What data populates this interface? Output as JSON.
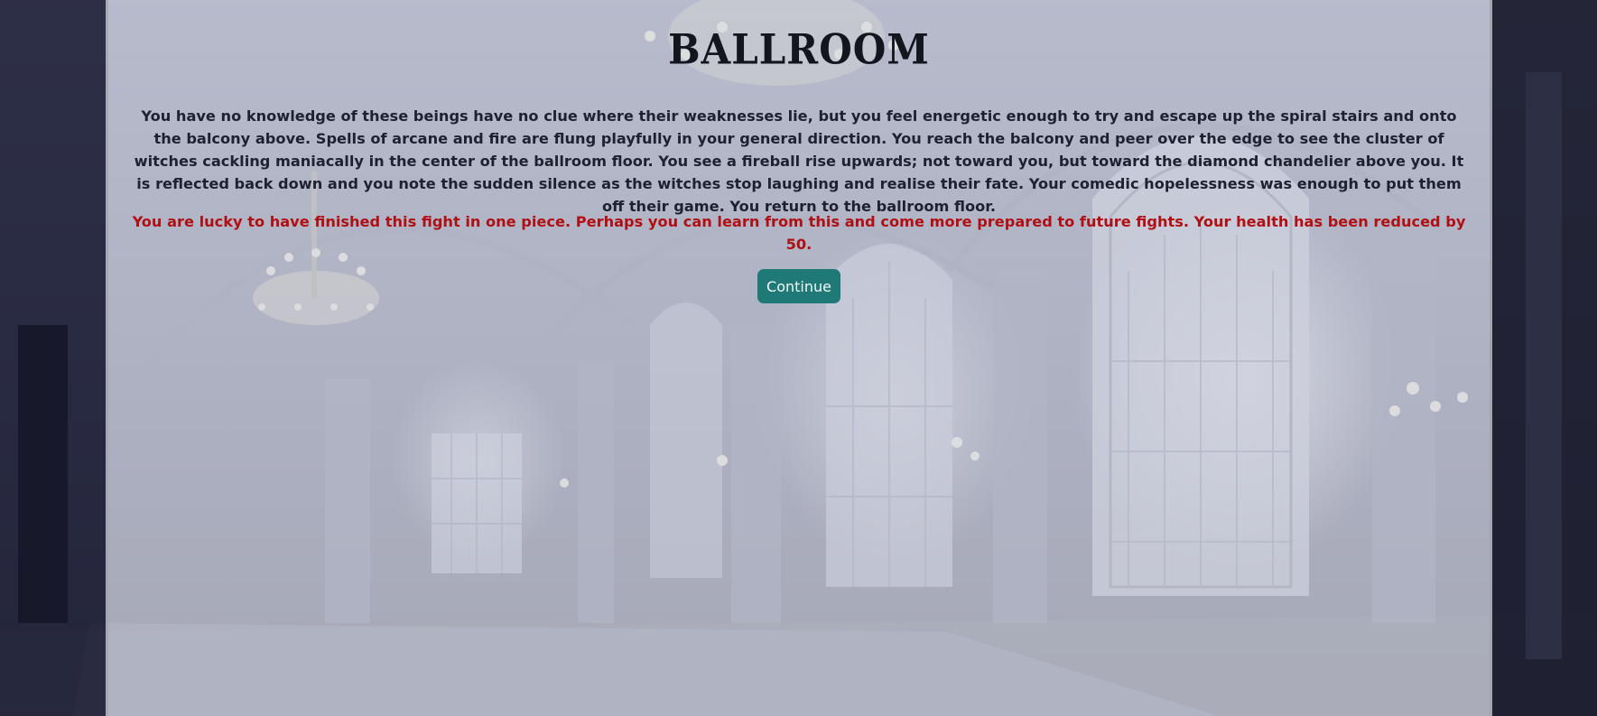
{
  "scene": {
    "title": "BALLROOM",
    "story": "You have no knowledge of these beings have no clue where their weaknesses lie, but you feel energetic enough to try and escape up the spiral stairs and onto the balcony above. Spells of arcane and fire are flung playfully in your general direction. You reach the balcony and peer over the edge to see the cluster of witches cackling maniacally in the center of the ballroom floor. You see a fireball rise upwards; not toward you, but toward the diamond chandelier above you. It is reflected back down and you note the sudden silence as the witches stop laughing and realise their fate. Your comedic hopelessness was enough to put them off their game. You return to the ballroom floor.",
    "outcome": "You are lucky to have finished this fight in one piece. Perhaps you can learn from this and come more prepared to future fights. Your health has been reduced by 50."
  },
  "actions": {
    "continue_label": "Continue"
  },
  "colors": {
    "outcome_text": "#b00f13",
    "button_bg": "#1f7a77",
    "button_text": "#f2f7f7",
    "panel_overlay": "#d6d8e2"
  },
  "background": {
    "depicts": "ballroom-interior-icon"
  }
}
